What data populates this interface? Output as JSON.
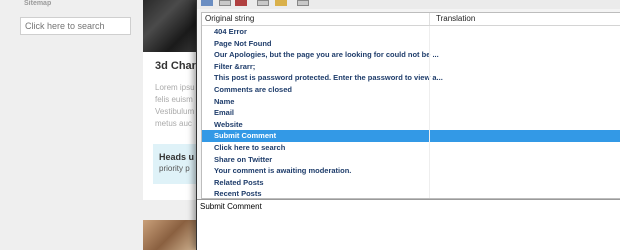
{
  "website": {
    "sitemap_label": "Sitemap",
    "search_placeholder": "Click here to search",
    "card": {
      "title": "3d Chara",
      "body_lines": [
        "Lorem ipsu",
        "felis euism",
        "Vestibulum",
        "metus auc"
      ],
      "callout_heading": "Heads u",
      "callout_text": "priority p"
    }
  },
  "table": {
    "headers": {
      "original": "Original string",
      "translation": "Translation"
    },
    "rows": [
      "404 Error",
      "Page Not Found",
      "Our Apologies, but the page you are looking for could not be ...",
      "Filter &rarr;",
      "This post is password protected. Enter the password to view a...",
      "Comments are closed",
      "Name",
      "Email",
      "Website",
      "Submit Comment",
      "Click here to search",
      "Share on Twitter",
      "Your comment is awaiting moderation.",
      "Related Posts",
      "Recent Posts"
    ],
    "selected_index": 9
  },
  "editor": {
    "text": "Submit Comment"
  },
  "colors": {
    "selection": "#3399e6",
    "row_text": "#1f3d6b"
  },
  "icons": [
    "save-icon",
    "edit-icon",
    "validate-icon",
    "catalog-icon",
    "settings-icon",
    "expand-icon"
  ]
}
